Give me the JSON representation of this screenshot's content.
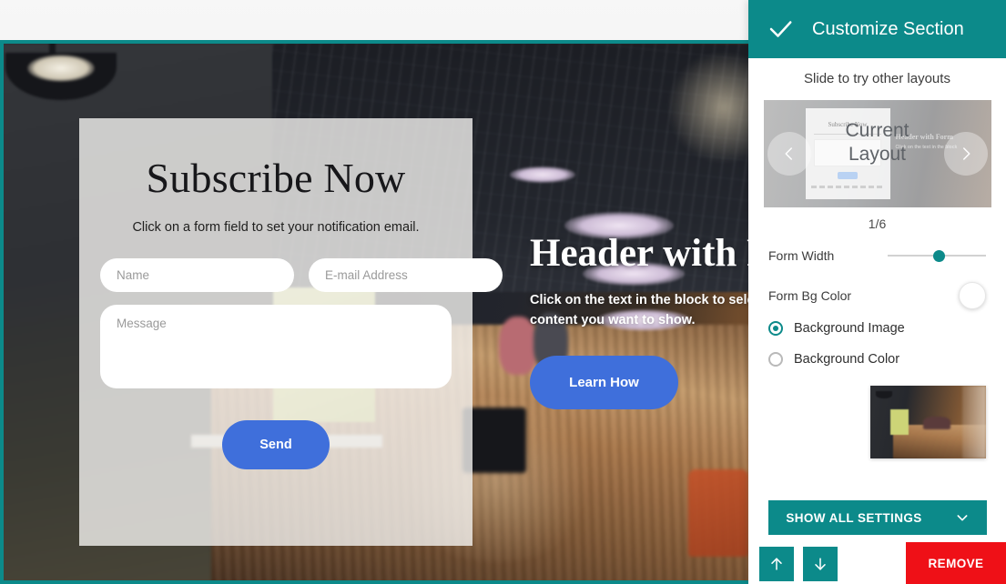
{
  "panel": {
    "header": {
      "title": "Customize Section",
      "confirm_icon": "check-icon"
    },
    "slide_hint": "Slide to try other layouts",
    "carousel": {
      "overlay_label": "Current\nLayout",
      "overlay_line1": "Current",
      "overlay_line2": "Layout",
      "pager": "1/6",
      "prev_icon": "chevron-left-icon",
      "next_icon": "chevron-right-icon",
      "mini_preview": {
        "title": "Subscribe Now",
        "hero_title": "Header with Form",
        "hero_text": "Click on the text in the block"
      }
    },
    "controls": {
      "form_width_label": "Form Width",
      "form_width_value": 52,
      "form_bg_color_label": "Form  Bg Color",
      "form_bg_color_value": "#ffffff",
      "radios": [
        {
          "label": "Background Image",
          "selected": true
        },
        {
          "label": "Background Color",
          "selected": false
        }
      ],
      "image_thumbnail_name": "office-interior-thumbnail"
    },
    "actions": {
      "show_all_settings": "SHOW ALL SETTINGS",
      "show_all_chevron": "chevron-down-icon",
      "move_up_icon": "arrow-up-icon",
      "move_down_icon": "arrow-down-icon",
      "remove_label": "REMOVE"
    },
    "colors": {
      "accent_teal": "#0c8a8a",
      "danger_red": "#ef1017",
      "button_blue": "#3f6fdb"
    }
  },
  "canvas": {
    "form": {
      "title": "Subscribe Now",
      "subtitle": "Click on a form field to set your notification email.",
      "name_placeholder": "Name",
      "name_value": "",
      "email_placeholder": "E-mail Address",
      "email_value": "",
      "message_placeholder": "Message",
      "message_value": "",
      "submit_label": "Send"
    },
    "hero": {
      "heading": "Header with Form",
      "paragraph": "Click on the text in the block to select the content you want to show.",
      "cta_label": "Learn How"
    }
  }
}
